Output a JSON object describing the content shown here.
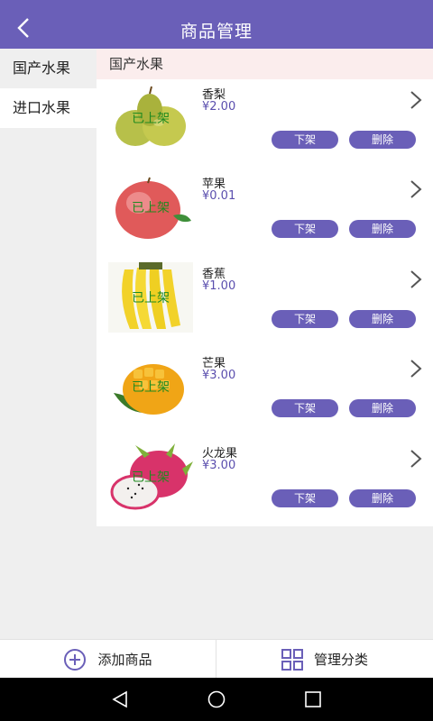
{
  "header": {
    "title": "商品管理",
    "back_icon": "back-arrow-icon"
  },
  "categories": [
    {
      "label": "国产水果",
      "active": false
    },
    {
      "label": "进口水果",
      "active": true
    }
  ],
  "section": {
    "title": "国产水果"
  },
  "status_label": "已上架",
  "products": [
    {
      "name": "香梨",
      "price": "¥2.00",
      "status": "已上架",
      "offline_label": "下架",
      "delete_label": "删除",
      "image": "pear-image"
    },
    {
      "name": "苹果",
      "price": "¥0.01",
      "status": "已上架",
      "offline_label": "下架",
      "delete_label": "删除",
      "image": "apple-image"
    },
    {
      "name": "香蕉",
      "price": "¥1.00",
      "status": "已上架",
      "offline_label": "下架",
      "delete_label": "删除",
      "image": "banana-image"
    },
    {
      "name": "芒果",
      "price": "¥3.00",
      "status": "已上架",
      "offline_label": "下架",
      "delete_label": "删除",
      "image": "mango-image"
    },
    {
      "name": "火龙果",
      "price": "¥3.00",
      "status": "已上架",
      "offline_label": "下架",
      "delete_label": "删除",
      "image": "dragonfruit-image"
    }
  ],
  "bottom": {
    "add_label": "添加商品",
    "manage_label": "管理分类"
  },
  "colors": {
    "primary": "#6a5fb8",
    "status_green": "#1f8a1f",
    "section_bg": "#fbeded"
  }
}
